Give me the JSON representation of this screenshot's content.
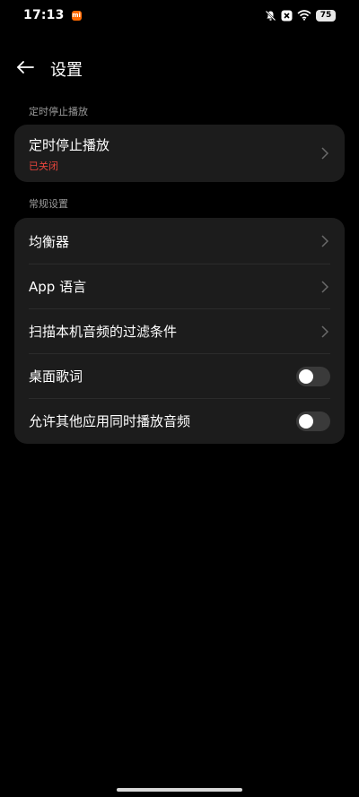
{
  "status_bar": {
    "time": "17:13",
    "brand_badge": "mi",
    "icons": [
      "mute-bell-icon",
      "close-box-icon",
      "wifi-icon"
    ],
    "battery": "75"
  },
  "header": {
    "title": "设置"
  },
  "sections": {
    "timer": {
      "label": "定时停止播放",
      "item": {
        "title": "定时停止播放",
        "status": "已关闭"
      }
    },
    "general": {
      "label": "常规设置",
      "items": [
        {
          "label": "均衡器",
          "type": "link"
        },
        {
          "label": "App 语言",
          "type": "link"
        },
        {
          "label": "扫描本机音频的过滤条件",
          "type": "link"
        },
        {
          "label": "桌面歌词",
          "type": "toggle",
          "on": false
        },
        {
          "label": "允许其他应用同时播放音频",
          "type": "toggle",
          "on": false
        }
      ]
    }
  },
  "colors": {
    "background": "#000000",
    "card": "#1c1c1c",
    "secondary_text": "#9a9a9a",
    "status_off": "#e8453c",
    "toggle_track_off": "#3a3a3a"
  }
}
